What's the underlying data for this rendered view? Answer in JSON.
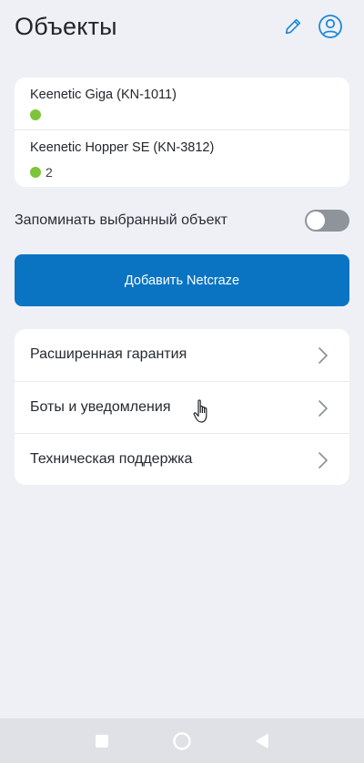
{
  "header": {
    "title": "Объекты",
    "edit_icon": "pencil-icon",
    "account_icon": "user-circle-icon"
  },
  "devices": [
    {
      "name": "Keenetic Giga (KN-1011)",
      "status": "online",
      "count": ""
    },
    {
      "name": "Keenetic Hopper SE (KN-3812)",
      "status": "online",
      "count": "2"
    }
  ],
  "remember": {
    "label": "Запоминать выбранный объект",
    "enabled": false
  },
  "add_button": {
    "label": "Добавить Netcraze"
  },
  "menu": [
    {
      "label": "Расширенная гарантия"
    },
    {
      "label": "Боты и уведомления"
    },
    {
      "label": "Техническая поддержка"
    }
  ],
  "colors": {
    "accent": "#0a74c2",
    "status_online": "#7cc43a",
    "background": "#eef0f5",
    "toggle_off": "#8f949b"
  },
  "navbar": {
    "recent_icon": "square-icon",
    "home_icon": "circle-icon",
    "back_icon": "triangle-back-icon"
  }
}
